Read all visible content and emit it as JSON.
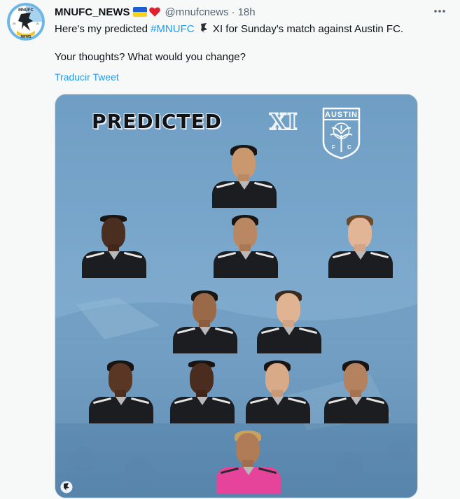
{
  "author": {
    "name": "MNUFC_NEWS",
    "handle": "@mnufcnews",
    "separator": "·",
    "time": "18h",
    "avatar_label_top": "MNUFC",
    "avatar_label_bottom": "NEWS",
    "avatar_year_left": "20",
    "avatar_year_right": "21"
  },
  "tweet": {
    "text_before": "Here's my predicted ",
    "hashtag": "#MNUFC",
    "text_after": " XI for Sunday's match against Austin FC.",
    "question": "Your thoughts? What would you change?"
  },
  "translate_label": "Traducir Tweet",
  "more_icon": "more-horizontal-icon",
  "media": {
    "title": "PREDICTED",
    "xi": "XI",
    "crest_label": "AUSTIN",
    "crest_letters_left": "F",
    "crest_letters_right": "C"
  },
  "colors": {
    "link": "#1d9bf0",
    "text": "#0f1419",
    "muted": "#536471",
    "media_blue": "#79a6cb",
    "keeper_pink": "#e6439a"
  }
}
